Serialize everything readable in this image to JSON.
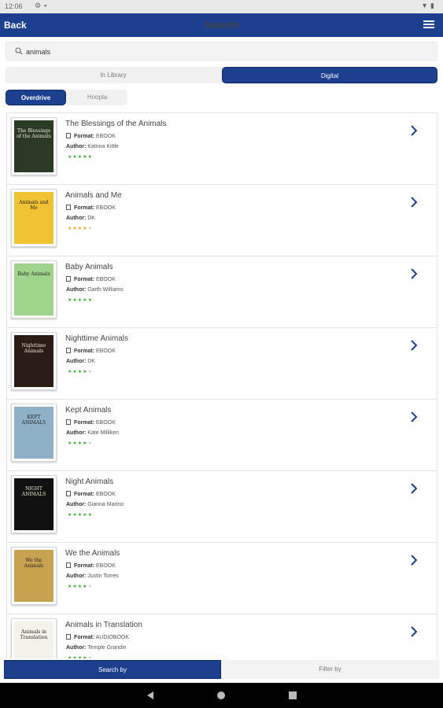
{
  "status_bar": {
    "time": "12:06",
    "icons": [
      "gear-icon",
      "sd-card-icon"
    ],
    "right_icons": [
      "wifi-icon",
      "battery-icon"
    ]
  },
  "app_bar": {
    "back_label": "Back",
    "title": "Search",
    "menu_icon": "hamburger-menu-icon"
  },
  "search": {
    "value": "animals",
    "icon": "search-icon"
  },
  "source_tabs": {
    "left": "In Library",
    "right": "Digital",
    "selected": "Digital"
  },
  "provider_tabs": {
    "active": "Overdrive",
    "inactive": "Hoopla"
  },
  "results": [
    {
      "title": "The Blessings of the Animals",
      "format_label": "Format:",
      "format": "EBOOK",
      "author_label": "Author:",
      "author": "Katrina Kittle",
      "rating": 5,
      "cover_text": "The Blessings of the Animals",
      "cover_bg": "#2a3a25"
    },
    {
      "title": "Animals and Me",
      "format_label": "Format:",
      "format": "EBOOK",
      "author_label": "Author:",
      "author": "DK",
      "rating": 4,
      "cover_text": "Animals and Me",
      "cover_bg": "#f1c232"
    },
    {
      "title": "Baby Animals",
      "format_label": "Format:",
      "format": "EBOOK",
      "author_label": "Author:",
      "author": "Garth Williams",
      "rating": 5,
      "cover_text": "Baby Animals",
      "cover_bg": "#9fd48a"
    },
    {
      "title": "Nighttime Animals",
      "format_label": "Format:",
      "format": "EBOOK",
      "author_label": "Author:",
      "author": "DK",
      "rating": 4,
      "cover_text": "Nighttime Animals",
      "cover_bg": "#2b1d16"
    },
    {
      "title": "Kept Animals",
      "format_label": "Format:",
      "format": "EBOOK",
      "author_label": "Author:",
      "author": "Kate Milliken",
      "rating": 4,
      "cover_text": "KEPT ANIMALS",
      "cover_bg": "#8fb1c7"
    },
    {
      "title": "Night Animals",
      "format_label": "Format:",
      "format": "EBOOK",
      "author_label": "Author:",
      "author": "Gianna Marino",
      "rating": 5,
      "cover_text": "NIGHT ANIMALS",
      "cover_bg": "#111111"
    },
    {
      "title": "We the Animals",
      "format_label": "Format:",
      "format": "EBOOK",
      "author_label": "Author:",
      "author": "Justin Torres",
      "rating": 4,
      "cover_text": "We the Animals",
      "cover_bg": "#c9a24f"
    },
    {
      "title": "Animals in Translation",
      "format_label": "Format:",
      "format": "AUDIOBOOK",
      "author_label": "Author:",
      "author": "Temple Grandin",
      "rating": 4,
      "cover_text": "Animals in Translation",
      "cover_bg": "#f5f2ea"
    }
  ],
  "bottom_tabs": {
    "active": "Search by",
    "inactive": "Filter by"
  },
  "colors": {
    "primary": "#1c3f8f",
    "star_green": "#3fa535",
    "star_empty": "#c8c8c8",
    "star_gold": "#e0a21b"
  }
}
